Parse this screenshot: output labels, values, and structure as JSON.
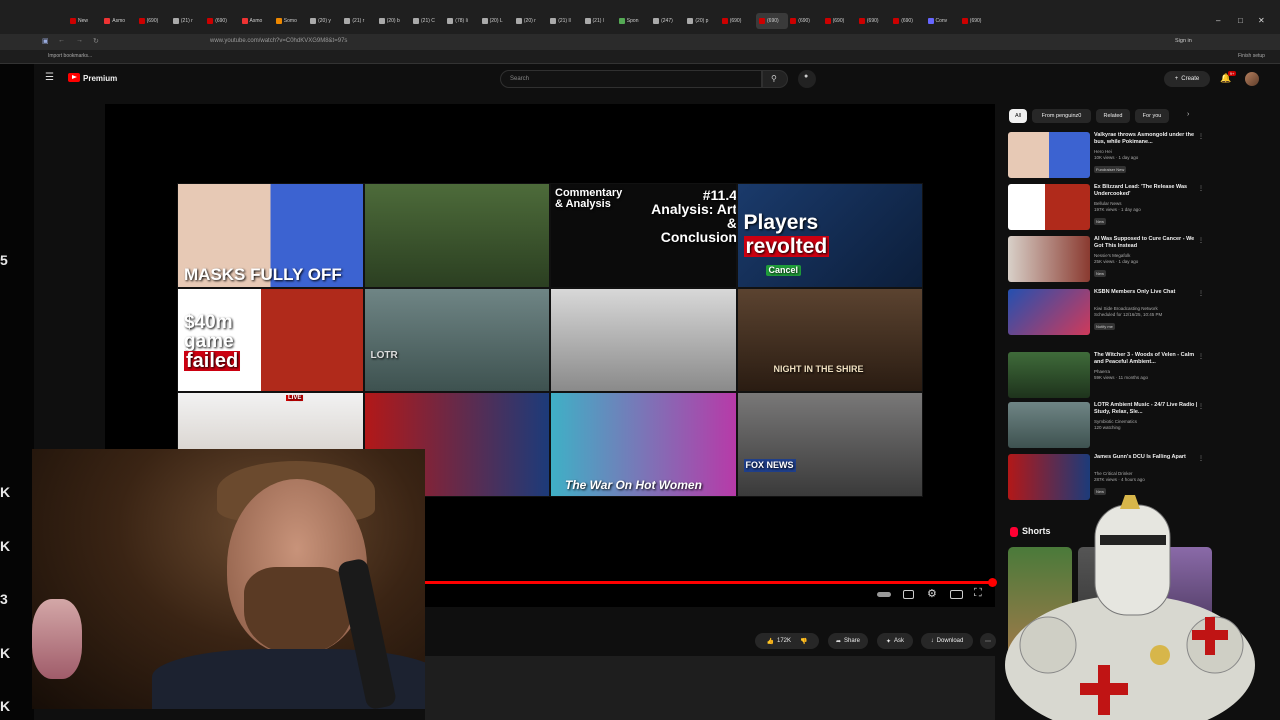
{
  "browser": {
    "tabs": [
      "New",
      "Asmo",
      "(690)",
      "(21) r",
      "(690)",
      "Asmo",
      "Somo",
      "(20) y",
      "(21) r",
      "(20) b",
      "(21) C",
      "(78) li",
      "(20) L",
      "(20) r",
      "(21) ll",
      "(21) l",
      "Spon",
      "(247)",
      "(20) p",
      "(690)",
      "(690)",
      "(690)",
      "(690)",
      "(690)",
      "(690)",
      "Conv",
      "(690)"
    ],
    "active_tab_index": 20,
    "url": "www.youtube.com/watch?v=C0hdKVXG9M8&t=97s",
    "bookmark": "Import bookmarks...",
    "sign_in": "Sign in",
    "finish_setup": "Finish setup"
  },
  "youtube": {
    "brand": "Premium",
    "search_placeholder": "Search",
    "create_label": "Create",
    "notif_count": "9+"
  },
  "left_numbers": [
    "5",
    "K",
    "K",
    "3",
    "K",
    "K"
  ],
  "video": {
    "tiles": [
      {
        "caption": "MASKS FULLY OFF"
      },
      {
        "caption": ""
      },
      {
        "caption_a": "Commentary & Analysis",
        "caption_b": "#11.4 Analysis: Art & Conclusion"
      },
      {
        "caption_a": "Players",
        "caption_b": "revolted",
        "caption_c": "Cancel"
      },
      {
        "caption_a": "$40m game",
        "caption_b": "failed"
      },
      {
        "caption": "LOTR"
      },
      {
        "caption": ""
      },
      {
        "caption": "NIGHT IN THE SHIRE"
      },
      {
        "caption": "LIVE"
      },
      {
        "caption": ""
      },
      {
        "caption": "The War On Hot Women"
      },
      {
        "caption": "FOX NEWS"
      }
    ],
    "progress": 0.99
  },
  "actions": {
    "likes": "172K",
    "share": "Share",
    "ask": "Ask",
    "download": "Download"
  },
  "sidebar": {
    "chips": [
      "All",
      "From penguinz0",
      "Related",
      "For you"
    ],
    "recommendations": [
      {
        "title": "Valkyrae throws Asmongold under the bus, while Pokimane...",
        "channel": "Hero Hei",
        "meta": "10K views · 1 day ago",
        "badge": "Fundraiser  New"
      },
      {
        "title": "Ex Blizzard Lead: 'The Release Was Undercooked'",
        "channel": "Bellular News",
        "meta": "197K views · 1 day ago",
        "badge": "New"
      },
      {
        "title": "AI Was Supposed to Cure Cancer - We Got This Instead",
        "channel": "Nessie's Megafolk",
        "meta": "25K views · 1 day ago",
        "badge": "New"
      },
      {
        "title": "KSBN Members Only Live Chat",
        "channel": "Kiwi Side Broadcasting Network",
        "meta": "Scheduled for 12/16/25, 10:45 PM",
        "badge": "Notify me"
      },
      {
        "title": "The Witcher 3 - Woods of Velen - Calm and Peaceful Ambient...",
        "channel": "Phaerra",
        "meta": "59K views · 11 months ago",
        "badge": ""
      },
      {
        "title": "LOTR Ambient Music - 24/7 Live Radio | Study, Relax, Sle...",
        "channel": "Symbiotic Cinematics",
        "meta": "120 watching",
        "badge": ""
      },
      {
        "title": "James Gunn's DCU Is Falling Apart",
        "channel": "The Critical Drinker",
        "meta": "287K views · 4 hours ago",
        "badge": "New"
      }
    ],
    "shorts_label": "Shorts"
  },
  "colors": {
    "brand_red": "#ff0000",
    "background": "#0f0f0f",
    "chip_selected": "#f1f1f1"
  }
}
